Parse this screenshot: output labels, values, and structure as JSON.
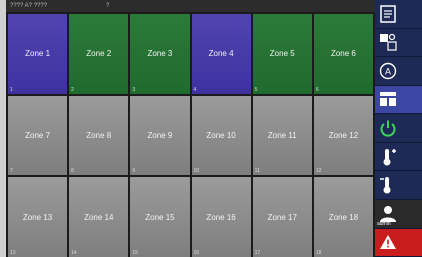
{
  "status_bar": {
    "left": "???? A? ????",
    "center": "?"
  },
  "zones": [
    {
      "label": "Zone 1",
      "color": "blue",
      "corner": "1"
    },
    {
      "label": "Zone 2",
      "color": "green",
      "corner": "2"
    },
    {
      "label": "Zone 3",
      "color": "green",
      "corner": "3"
    },
    {
      "label": "Zone 4",
      "color": "blue",
      "corner": "4"
    },
    {
      "label": "Zone 5",
      "color": "green",
      "corner": "5"
    },
    {
      "label": "Zone 6",
      "color": "green",
      "corner": "6"
    },
    {
      "label": "Zone 7",
      "color": "gray",
      "corner": "7"
    },
    {
      "label": "Zone 8",
      "color": "gray",
      "corner": "8"
    },
    {
      "label": "Zone 9",
      "color": "gray",
      "corner": "9"
    },
    {
      "label": "Zone 10",
      "color": "gray",
      "corner": "10"
    },
    {
      "label": "Zone 11",
      "color": "gray",
      "corner": "11"
    },
    {
      "label": "Zone 12",
      "color": "gray",
      "corner": "12"
    },
    {
      "label": "Zone 13",
      "color": "gray",
      "corner": "13"
    },
    {
      "label": "Zone 14",
      "color": "gray",
      "corner": "14"
    },
    {
      "label": "Zone 15",
      "color": "gray",
      "corner": "15"
    },
    {
      "label": "Zone 16",
      "color": "gray",
      "corner": "16"
    },
    {
      "label": "Zone 17",
      "color": "gray",
      "corner": "17"
    },
    {
      "label": "Zone 18",
      "color": "gray",
      "corner": "18"
    }
  ],
  "sidebar": {
    "items": [
      {
        "name": "document",
        "text": ""
      },
      {
        "name": "program",
        "text": ""
      },
      {
        "name": "auto",
        "text": ""
      },
      {
        "name": "layout",
        "text": ""
      },
      {
        "name": "power",
        "text": ""
      },
      {
        "name": "temperature-up",
        "text": ""
      },
      {
        "name": "temperature-down",
        "text": ""
      },
      {
        "name": "user",
        "text": "",
        "sub": "admin"
      },
      {
        "name": "alarm",
        "text": ""
      }
    ]
  },
  "colors": {
    "zone_blue": "#4a3ea9",
    "zone_green": "#237231",
    "zone_gray": "#8c8c8c",
    "sidebar_bg": "#1d2a55",
    "alarm": "#c91c1c"
  }
}
